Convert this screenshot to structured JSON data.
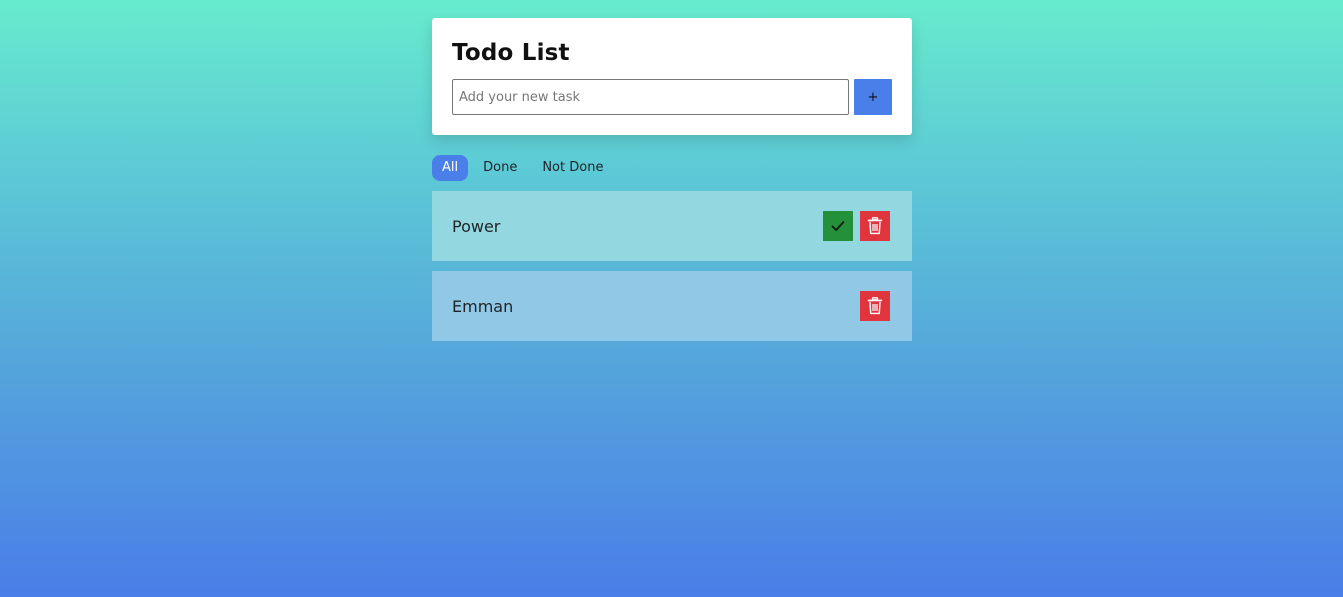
{
  "header": {
    "title": "Todo List"
  },
  "new_task": {
    "placeholder": "Add your new task",
    "value": "",
    "add_label": "+"
  },
  "filters": [
    {
      "label": "All",
      "active": true
    },
    {
      "label": "Done",
      "active": false
    },
    {
      "label": "Not Done",
      "active": false
    }
  ],
  "tasks": [
    {
      "label": "Power",
      "done": false,
      "actions": [
        "check-icon",
        "trash-icon"
      ]
    },
    {
      "label": "Emman",
      "done": true,
      "actions": [
        "trash-icon"
      ]
    }
  ],
  "colors": {
    "accent": "#4a7ee8",
    "done_button": "#24913a",
    "delete_button": "#e0353d",
    "card": "#ffffff"
  }
}
